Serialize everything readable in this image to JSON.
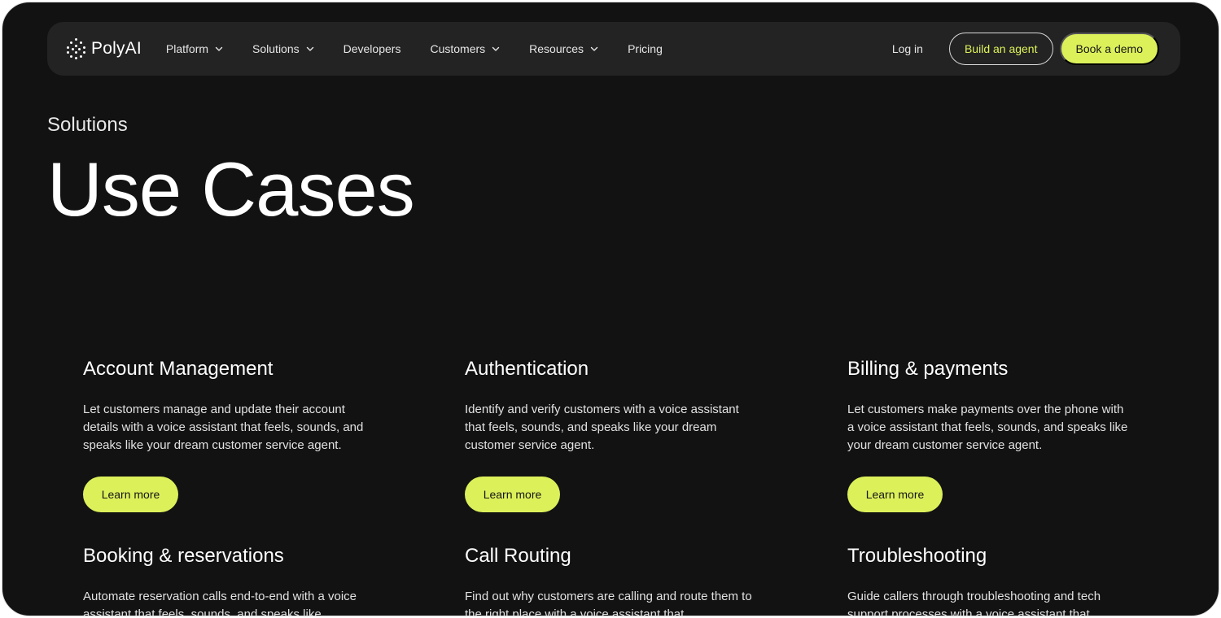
{
  "nav": {
    "logo_text": "PolyAI",
    "items": [
      {
        "label": "Platform",
        "dropdown": true
      },
      {
        "label": "Solutions",
        "dropdown": true
      },
      {
        "label": "Developers",
        "dropdown": false
      },
      {
        "label": "Customers",
        "dropdown": true
      },
      {
        "label": "Resources",
        "dropdown": true
      },
      {
        "label": "Pricing",
        "dropdown": false
      }
    ],
    "login_label": "Log in",
    "build_agent_label": "Build an agent",
    "book_demo_label": "Book a demo"
  },
  "hero": {
    "eyebrow": "Solutions",
    "title": "Use Cases"
  },
  "cards": [
    {
      "title": "Account Management",
      "body": "Let customers manage and update their account details with a voice assistant that feels, sounds, and speaks like your dream customer service agent.",
      "cta": "Learn more"
    },
    {
      "title": "Authentication",
      "body": "Identify and verify customers with a voice assistant that feels, sounds, and speaks like your dream customer service agent.",
      "cta": "Learn more"
    },
    {
      "title": "Billing & payments",
      "body": "Let customers make payments over the phone with a voice assistant that feels, sounds, and speaks like your dream customer service agent.",
      "cta": "Learn more"
    },
    {
      "title": "Booking & reservations",
      "body": "Automate reservation calls end-to-end with a voice assistant that feels, sounds, and speaks like"
    },
    {
      "title": "Call Routing",
      "body": "Find out why customers are calling and route them to the right place with a voice assistant that"
    },
    {
      "title": "Troubleshooting",
      "body": "Guide callers through troubleshooting and tech support processes with a voice assistant that"
    }
  ],
  "colors": {
    "background": "#121212",
    "nav_background": "#232323",
    "accent": "#dcf05a"
  }
}
